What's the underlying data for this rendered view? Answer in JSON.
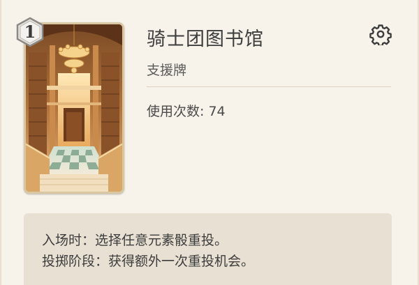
{
  "card": {
    "cost": "1",
    "title": "骑士团图书馆",
    "type": "支援牌",
    "usage_text": "使用次数: 74",
    "effects": [
      "入场时：选择任意元素骰重投。",
      "投掷阶段：获得额外一次重投机会。"
    ]
  },
  "icons": {
    "settings": "gear-icon",
    "cost_badge": "hexagon-badge-icon"
  },
  "colors": {
    "background": "#f7f2ea",
    "effect_background": "#e8e0d2",
    "card_frame": "#d9c7a4",
    "text": "#3d3d3d"
  }
}
